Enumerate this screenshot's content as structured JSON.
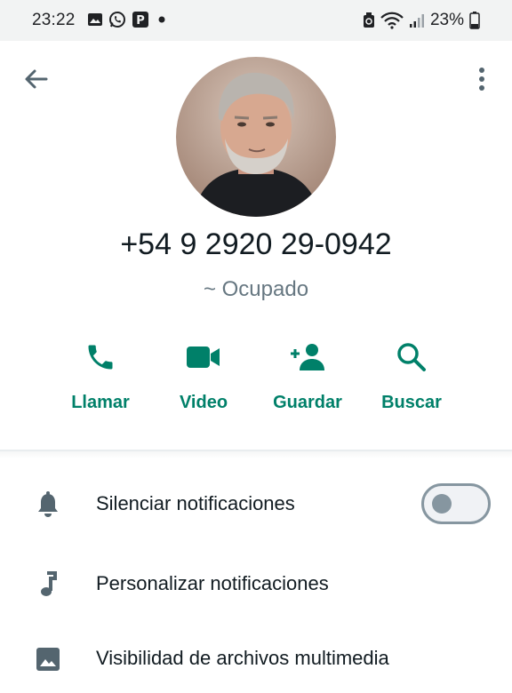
{
  "status_bar": {
    "time": "23:22",
    "battery": "23%",
    "left_icons": [
      "gallery-icon",
      "whatsapp-icon",
      "app-icon",
      "dot-icon"
    ],
    "right_icons": [
      "recycle-icon",
      "wifi-icon",
      "signal-icon",
      "battery-icon"
    ]
  },
  "contact": {
    "phone": "+54 9 2920 29-0942",
    "about": "~ Ocupado"
  },
  "actions": [
    {
      "label": "Llamar",
      "icon": "phone-icon"
    },
    {
      "label": "Video",
      "icon": "video-icon"
    },
    {
      "label": "Guardar",
      "icon": "add-contact-icon"
    },
    {
      "label": "Buscar",
      "icon": "search-icon"
    }
  ],
  "settings": [
    {
      "label": "Silenciar notificaciones",
      "icon": "bell-icon",
      "toggle": false
    },
    {
      "label": "Personalizar notificaciones",
      "icon": "music-note-icon"
    },
    {
      "label": "Visibilidad de archivos multimedia",
      "icon": "image-icon"
    }
  ],
  "colors": {
    "accent": "#008069",
    "icon_gray": "#54656f",
    "secondary_text": "#667781"
  }
}
